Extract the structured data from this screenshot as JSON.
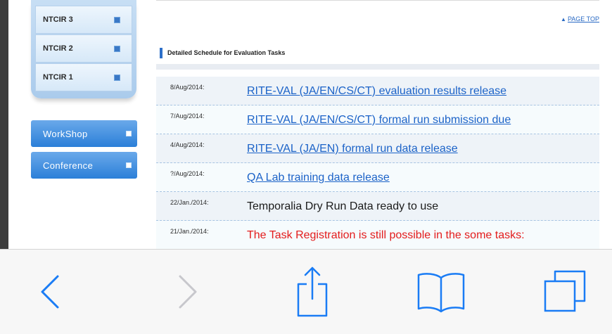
{
  "sidebar": {
    "ntcir_items": [
      {
        "label": "NTCIR 3"
      },
      {
        "label": "NTCIR 2"
      },
      {
        "label": "NTCIR 1"
      }
    ],
    "workshop_label": "WorkShop",
    "conference_label": "Conference"
  },
  "content": {
    "page_top_label": "PAGE TOP",
    "section_title": "Detailed Schedule for Evaluation Tasks",
    "schedule": [
      {
        "date": "8/Aug/2014:",
        "text": "RITE-VAL (JA/EN/CS/CT) evaluation results release",
        "style": "link"
      },
      {
        "date": "7/Aug/2014:",
        "text": "RITE-VAL (JA/EN/CS/CT) formal run submission due",
        "style": "link"
      },
      {
        "date": "4/Aug/2014:",
        "text": "RITE-VAL (JA/EN) formal run data release",
        "style": "link"
      },
      {
        "date": "?/Aug/2014:",
        "text": "QA Lab training data release",
        "style": "link"
      },
      {
        "date": "22/Jan./2014:",
        "text": "Temporalia Dry Run Data ready to use",
        "style": "plain"
      },
      {
        "date": "21/Jan./2014:",
        "text": "The Task Registration is still possible in the some tasks:",
        "style": "alert"
      }
    ]
  },
  "toolbar": {
    "icons": [
      "back-icon",
      "forward-icon",
      "share-icon",
      "bookmarks-icon",
      "tabs-icon"
    ],
    "accent": "#1a7cf5",
    "disabled": "#c7c7cc"
  }
}
